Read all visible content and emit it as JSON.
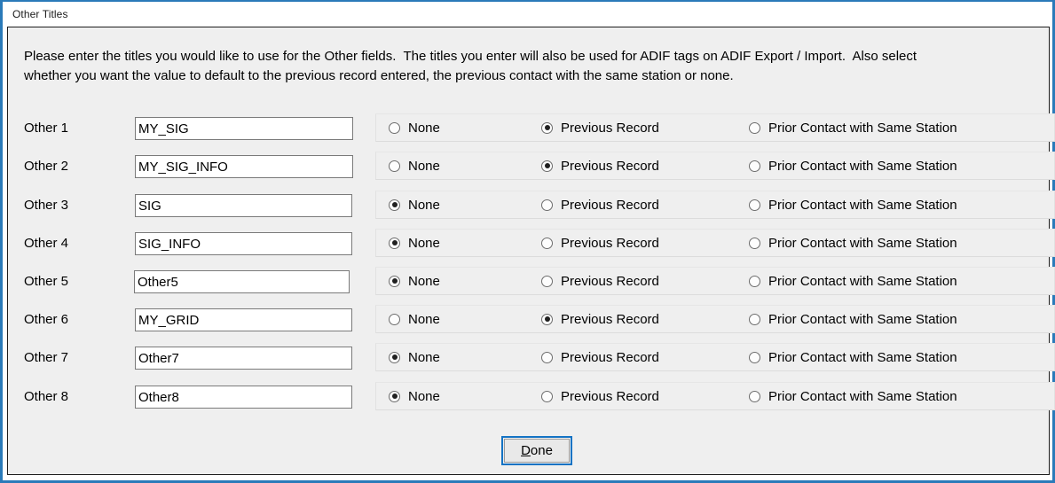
{
  "window": {
    "title": "Other Titles",
    "accent_color": "#2a7ab9",
    "panel_background": "#efefef"
  },
  "instructions": {
    "line1": "Please enter the titles you would like to use for the Other fields.  The titles you enter will also be used for ADIF tags on ADIF Export / Import.  Also select",
    "line2": "whether you want the value to default to the previous record entered, the previous contact with the same station or none."
  },
  "options": {
    "none": "None",
    "previous_record": "Previous Record",
    "prior_contact": "Prior Contact with Same Station"
  },
  "rows": [
    {
      "label": "Other 1",
      "value": "MY_SIG",
      "selected": "previous_record"
    },
    {
      "label": "Other 2",
      "value": "MY_SIG_INFO",
      "selected": "previous_record"
    },
    {
      "label": "Other 3",
      "value": "SIG",
      "selected": "none"
    },
    {
      "label": "Other 4",
      "value": "SIG_INFO",
      "selected": "none"
    },
    {
      "label": "Other 5",
      "value": "Other5",
      "selected": "none"
    },
    {
      "label": "Other 6",
      "value": "MY_GRID",
      "selected": "previous_record"
    },
    {
      "label": "Other 7",
      "value": "Other7",
      "selected": "none"
    },
    {
      "label": "Other 8",
      "value": "Other8",
      "selected": "none"
    }
  ],
  "done_button": {
    "accel": "D",
    "rest": "one",
    "focus_color": "#1473c4"
  }
}
